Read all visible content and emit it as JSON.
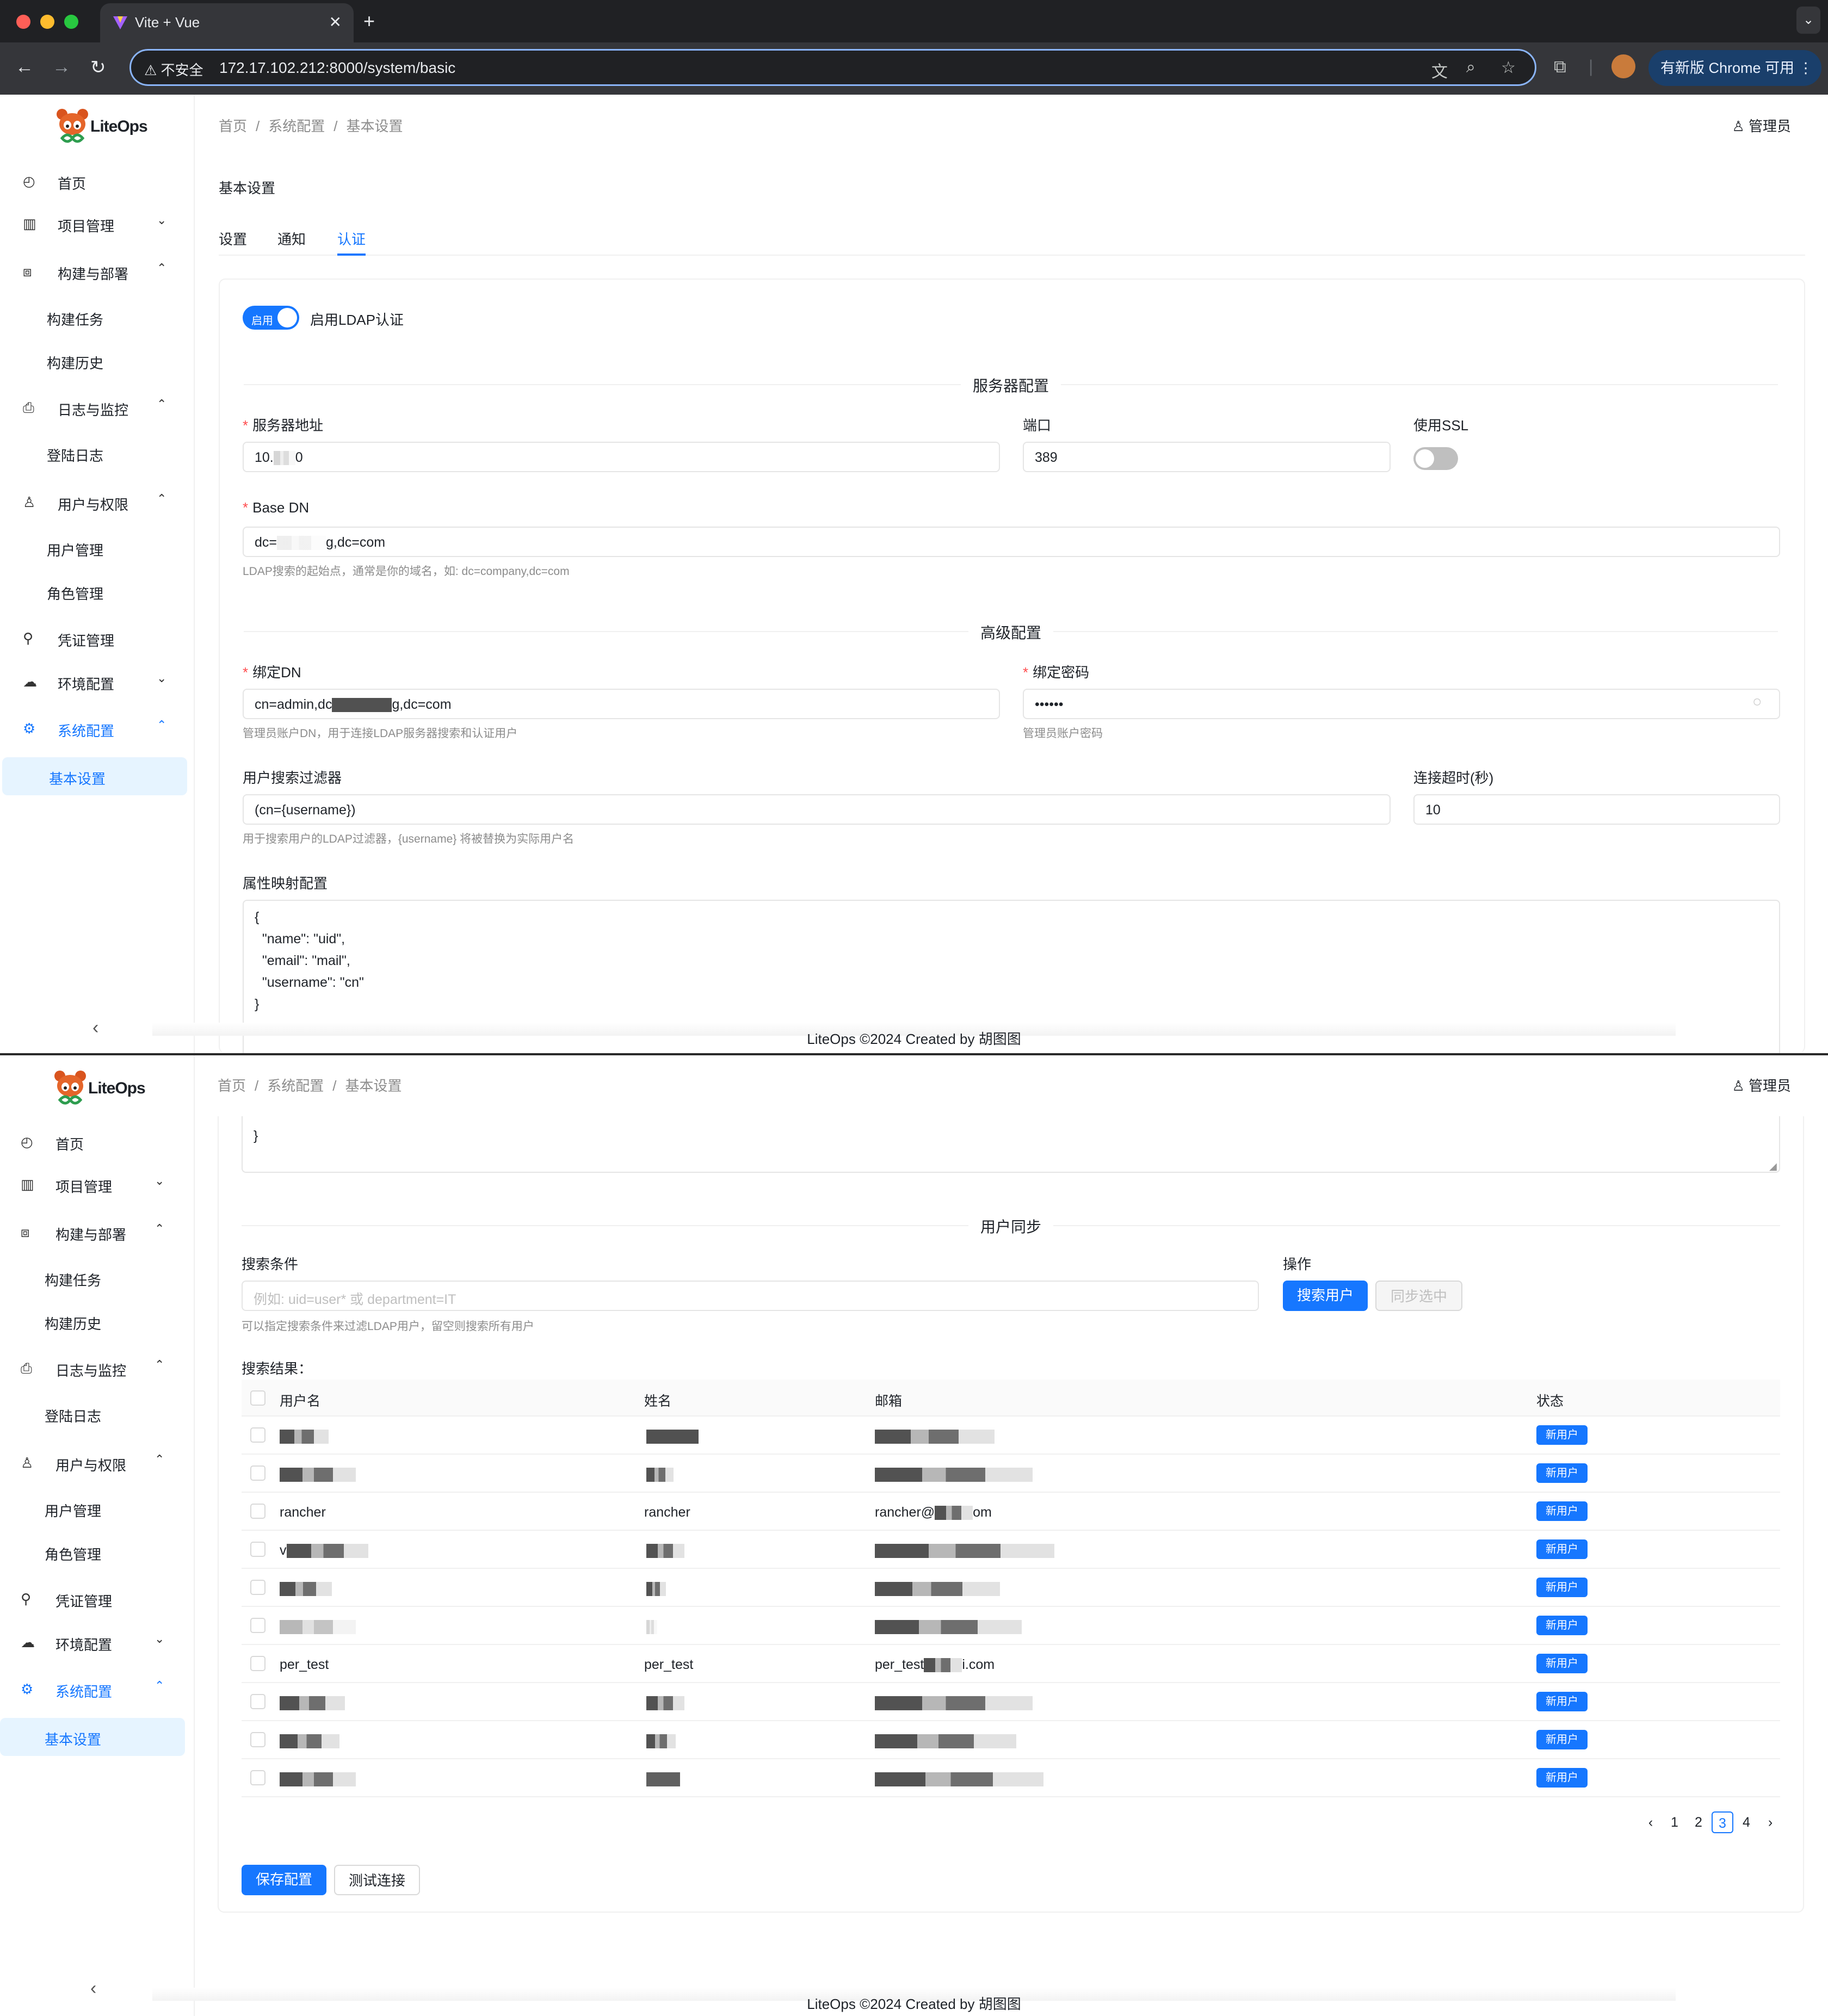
{
  "browser": {
    "tab_title": "Vite + Vue",
    "security": "不安全",
    "url": "172.17.102.212:8000/system/basic",
    "update_label": "有新版 Chrome 可用"
  },
  "app": {
    "brand": "LiteOps",
    "user": "管理员",
    "footer": "LiteOps ©2024 Created by 胡图图"
  },
  "breadcrumb": [
    "首页",
    "系统配置",
    "基本设置"
  ],
  "sidebar": {
    "items": [
      {
        "label": "首页",
        "icon": "dashboard-icon"
      },
      {
        "label": "项目管理",
        "icon": "project-icon"
      },
      {
        "label": "构建与部署",
        "icon": "build-icon"
      },
      {
        "label": "构建任务"
      },
      {
        "label": "构建历史"
      },
      {
        "label": "日志与监控",
        "icon": "log-icon"
      },
      {
        "label": "登陆日志"
      },
      {
        "label": "用户与权限",
        "icon": "user-icon"
      },
      {
        "label": "用户管理"
      },
      {
        "label": "角色管理"
      },
      {
        "label": "凭证管理",
        "icon": "key-icon"
      },
      {
        "label": "环境配置",
        "icon": "cloud-icon"
      },
      {
        "label": "系统配置",
        "icon": "gear-icon"
      },
      {
        "label": "基本设置"
      }
    ]
  },
  "page": {
    "title": "基本设置",
    "tabs": [
      "设置",
      "通知",
      "认证"
    ],
    "active_tab": "认证"
  },
  "ldap": {
    "switch_text": "启用",
    "enable_label": "启用LDAP认证",
    "server_section": "服务器配置",
    "server_label": "服务器地址",
    "server_value_pre": "10.",
    "server_value_post": "0",
    "port_label": "端口",
    "port_value": "389",
    "ssl_label": "使用SSL",
    "basedn_label": "Base DN",
    "basedn_pre": "dc=",
    "basedn_post": "g,dc=com",
    "basedn_help": "LDAP搜索的起始点，通常是你的域名，如: dc=company,dc=com",
    "advanced_section": "高级配置",
    "binddn_label": "绑定DN",
    "binddn_pre": "cn=admin,dc",
    "binddn_post": "g,dc=com",
    "binddn_help": "管理员账户DN，用于连接LDAP服务器搜索和认证用户",
    "bindpw_label": "绑定密码",
    "bindpw_value": "••••••",
    "bindpw_help": "管理员账户密码",
    "filter_label": "用户搜索过滤器",
    "filter_value": "(cn={username})",
    "filter_help": "用于搜索用户的LDAP过滤器，{username} 将被替换为实际用户名",
    "timeout_label": "连接超时(秒)",
    "timeout_value": "10",
    "attr_label": "属性映射配置",
    "attr_value": "{\n  \"name\": \"uid\",\n  \"email\": \"mail\",\n  \"username\": \"cn\"\n}",
    "attr_tail": "}"
  },
  "sync": {
    "section": "用户同步",
    "search_label": "搜索条件",
    "search_placeholder": "例如: uid=user* 或 department=IT",
    "search_help": "可以指定搜索条件来过滤LDAP用户，留空则搜索所有用户",
    "ops_label": "操作",
    "search_btn": "搜索用户",
    "sync_btn": "同步选中",
    "results_label": "搜索结果：",
    "columns": [
      "用户名",
      "姓名",
      "邮箱",
      "状态"
    ],
    "rows": [
      {
        "username": "",
        "name": "",
        "email": "",
        "status": "新用户"
      },
      {
        "username": "",
        "name": "",
        "email": "",
        "status": "新用户"
      },
      {
        "username": "rancher",
        "name": "rancher",
        "email_pre": "rancher@",
        "email_post": "om",
        "status": "新用户"
      },
      {
        "username_pre": "v",
        "name": "",
        "email": "",
        "status": "新用户"
      },
      {
        "username": "",
        "name": "",
        "email": "",
        "status": "新用户"
      },
      {
        "username": "",
        "name": "",
        "email": "",
        "status": "新用户"
      },
      {
        "username": "per_test",
        "name": "per_test",
        "email_pre": "per_test",
        "email_post": "i.com",
        "status": "新用户"
      },
      {
        "username": "",
        "name": "",
        "email": "",
        "status": "新用户"
      },
      {
        "username": "",
        "name": "",
        "email": "",
        "status": "新用户"
      },
      {
        "username": "",
        "name": "",
        "email": "",
        "status": "新用户"
      }
    ],
    "pages": [
      "1",
      "2",
      "3",
      "4"
    ],
    "current_page": "3"
  },
  "actions": {
    "save": "保存配置",
    "test": "测试连接"
  }
}
